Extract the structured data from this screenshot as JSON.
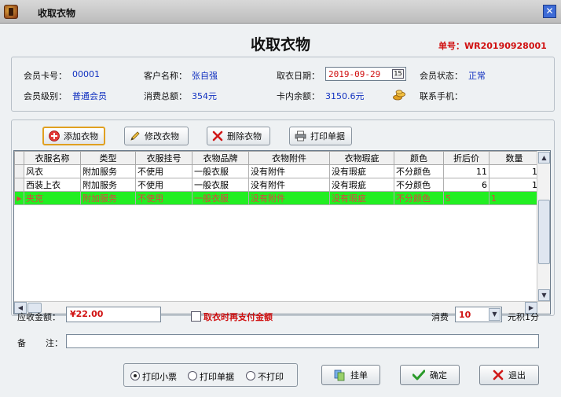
{
  "window": {
    "title": "收取衣物",
    "close_glyph": "✕"
  },
  "form": {
    "heading": "收取衣物",
    "order_no": "单号：WR20190928001"
  },
  "info": {
    "member_card_label": "会员卡号：",
    "member_card_value": "00001",
    "customer_name_label": "客户名称：",
    "customer_name_value": "张自强",
    "pickup_date_label": "取衣日期：",
    "pickup_date_value": "2019-09-29",
    "member_status_label": "会员状态：",
    "member_status_value": "正常",
    "member_level_label": "会员级别：",
    "member_level_value": "普通会员",
    "total_spent_label": "消费总额：",
    "total_spent_value": "354元",
    "card_balance_label": "卡内余额：",
    "card_balance_value": "3150.6元",
    "phone_label": "联系手机：",
    "date_picker_glyph": "15"
  },
  "toolbar": {
    "add": "添加衣物",
    "edit": "修改衣物",
    "delete": "删除衣物",
    "print": "打印单据"
  },
  "grid": {
    "columns": [
      "衣服名称",
      "类型",
      "衣服挂号",
      "衣物品牌",
      "衣物附件",
      "衣物瑕疵",
      "颜色",
      "折后价",
      "数量"
    ],
    "rows": [
      {
        "name": "风衣",
        "type": "附加服务",
        "hang": "不使用",
        "brand": "一般衣服",
        "accessory": "没有附件",
        "defect": "没有瑕疵",
        "color": "不分颜色",
        "price": "11",
        "qty": "1"
      },
      {
        "name": "西装上衣",
        "type": "附加服务",
        "hang": "不使用",
        "brand": "一般衣服",
        "accessory": "没有附件",
        "defect": "没有瑕疵",
        "color": "不分颜色",
        "price": "6",
        "qty": "1"
      },
      {
        "name": "夹克",
        "type": "附加服务",
        "hang": "不使用",
        "brand": "一般衣服",
        "accessory": "没有附件",
        "defect": "没有瑕疵",
        "color": "不分颜色",
        "price": "5",
        "qty": "1"
      }
    ],
    "row_indicator": "▶",
    "scroll_up": "▲",
    "scroll_down": "▼",
    "scroll_left": "◀",
    "scroll_right": "▶"
  },
  "payment": {
    "amount_label": "应收金额：",
    "amount_value": "¥22.00",
    "pay_later_label": "取衣时再支付金额",
    "consume_label": "消费",
    "consume_value": "10",
    "points_suffix": "元积1分",
    "remark_label_1": "备",
    "remark_label_2": "注：",
    "dropdown_glyph": "▼"
  },
  "print_options": {
    "print_ticket": "打印小票",
    "print_receipt": "打印单据",
    "no_print": "不打印",
    "selected": "print_ticket"
  },
  "actions": {
    "hang": "挂单",
    "confirm": "确定",
    "exit": "退出"
  },
  "colors": {
    "accent_red": "#d01010",
    "value_blue": "#1030c0",
    "selected_row": "#22ee22"
  }
}
